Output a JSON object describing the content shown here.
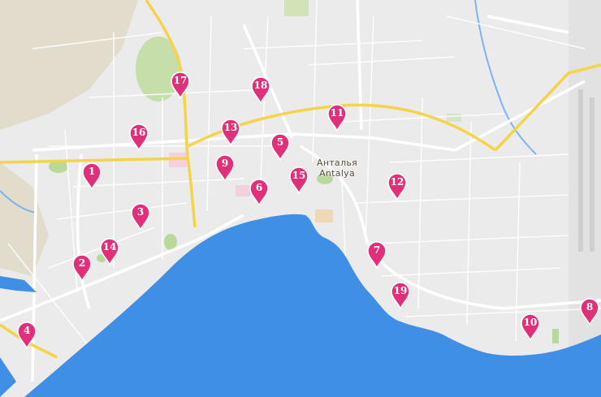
{
  "map": {
    "city_name_native": "Анталья",
    "city_name_latin": "Antalya",
    "colors": {
      "sea": "#3f8fe6",
      "land": "#ebebeb",
      "road_major": "#f5d44a",
      "road_minor": "#ffffff",
      "park": "#b8d99a",
      "marker": "#e0307a"
    }
  },
  "markers": [
    {
      "label": "1"
    },
    {
      "label": "2"
    },
    {
      "label": "3"
    },
    {
      "label": "4"
    },
    {
      "label": "5"
    },
    {
      "label": "6"
    },
    {
      "label": "7"
    },
    {
      "label": "8"
    },
    {
      "label": "9"
    },
    {
      "label": "10"
    },
    {
      "label": "11"
    },
    {
      "label": "12"
    },
    {
      "label": "13"
    },
    {
      "label": "14"
    },
    {
      "label": "15"
    },
    {
      "label": "16"
    },
    {
      "label": "17"
    },
    {
      "label": "18"
    },
    {
      "label": "19"
    }
  ]
}
